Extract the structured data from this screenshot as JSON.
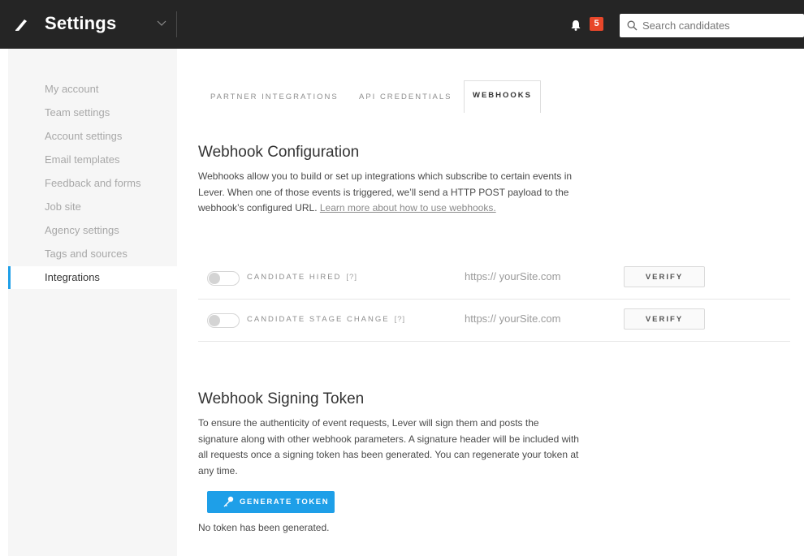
{
  "header": {
    "title": "Settings",
    "notification_count": "5",
    "search_placeholder": "Search candidates",
    "icons": [
      "pen-logo-icon",
      "chevron-down-icon",
      "bell-icon",
      "search-icon"
    ]
  },
  "sidebar": {
    "items": [
      {
        "label": "My account"
      },
      {
        "label": "Team settings"
      },
      {
        "label": "Account settings"
      },
      {
        "label": "Email templates"
      },
      {
        "label": "Feedback and forms"
      },
      {
        "label": "Job site"
      },
      {
        "label": "Agency settings"
      },
      {
        "label": "Tags and sources"
      }
    ],
    "active": {
      "label": "Integrations"
    }
  },
  "tabs": {
    "partner": "PARTNER INTEGRATIONS",
    "api": "API CREDENTIALS",
    "webhooks": "WEBHOOKS",
    "selected": "WEBHOOKS"
  },
  "config": {
    "heading": "Webhook Configuration",
    "description": "Webhooks allow you to build or set up integrations which subscribe to certain events in Lever. When one of those events is triggered, we’ll send a HTTP POST payload to the webhook’s configured URL.",
    "learn_more_link": "Learn more about how to use webhooks."
  },
  "webhooks": [
    {
      "label": "CANDIDATE HIRED",
      "help": "[?]",
      "url": "https:// yourSite.com",
      "verify": "VERIFY",
      "enabled": false
    },
    {
      "label": "CANDIDATE STAGE CHANGE",
      "help": "[?]",
      "url": "https:// yourSite.com",
      "verify": "VERIFY",
      "enabled": false
    }
  ],
  "signing": {
    "heading": "Webhook Signing Token",
    "description": "To ensure the authenticity of event requests, Lever will sign them and posts the signature along with other webhook parameters. A signature header will be included with all requests once a signing token has been generated. You can regenerate your token at any time.",
    "button": "GENERATE TOKEN",
    "status": "No token has been generated."
  },
  "colors": {
    "topbar": "#252525",
    "accent": "#1e9fe8",
    "badge": "#e8472a",
    "sidebar_bg": "#f6f6f6"
  }
}
